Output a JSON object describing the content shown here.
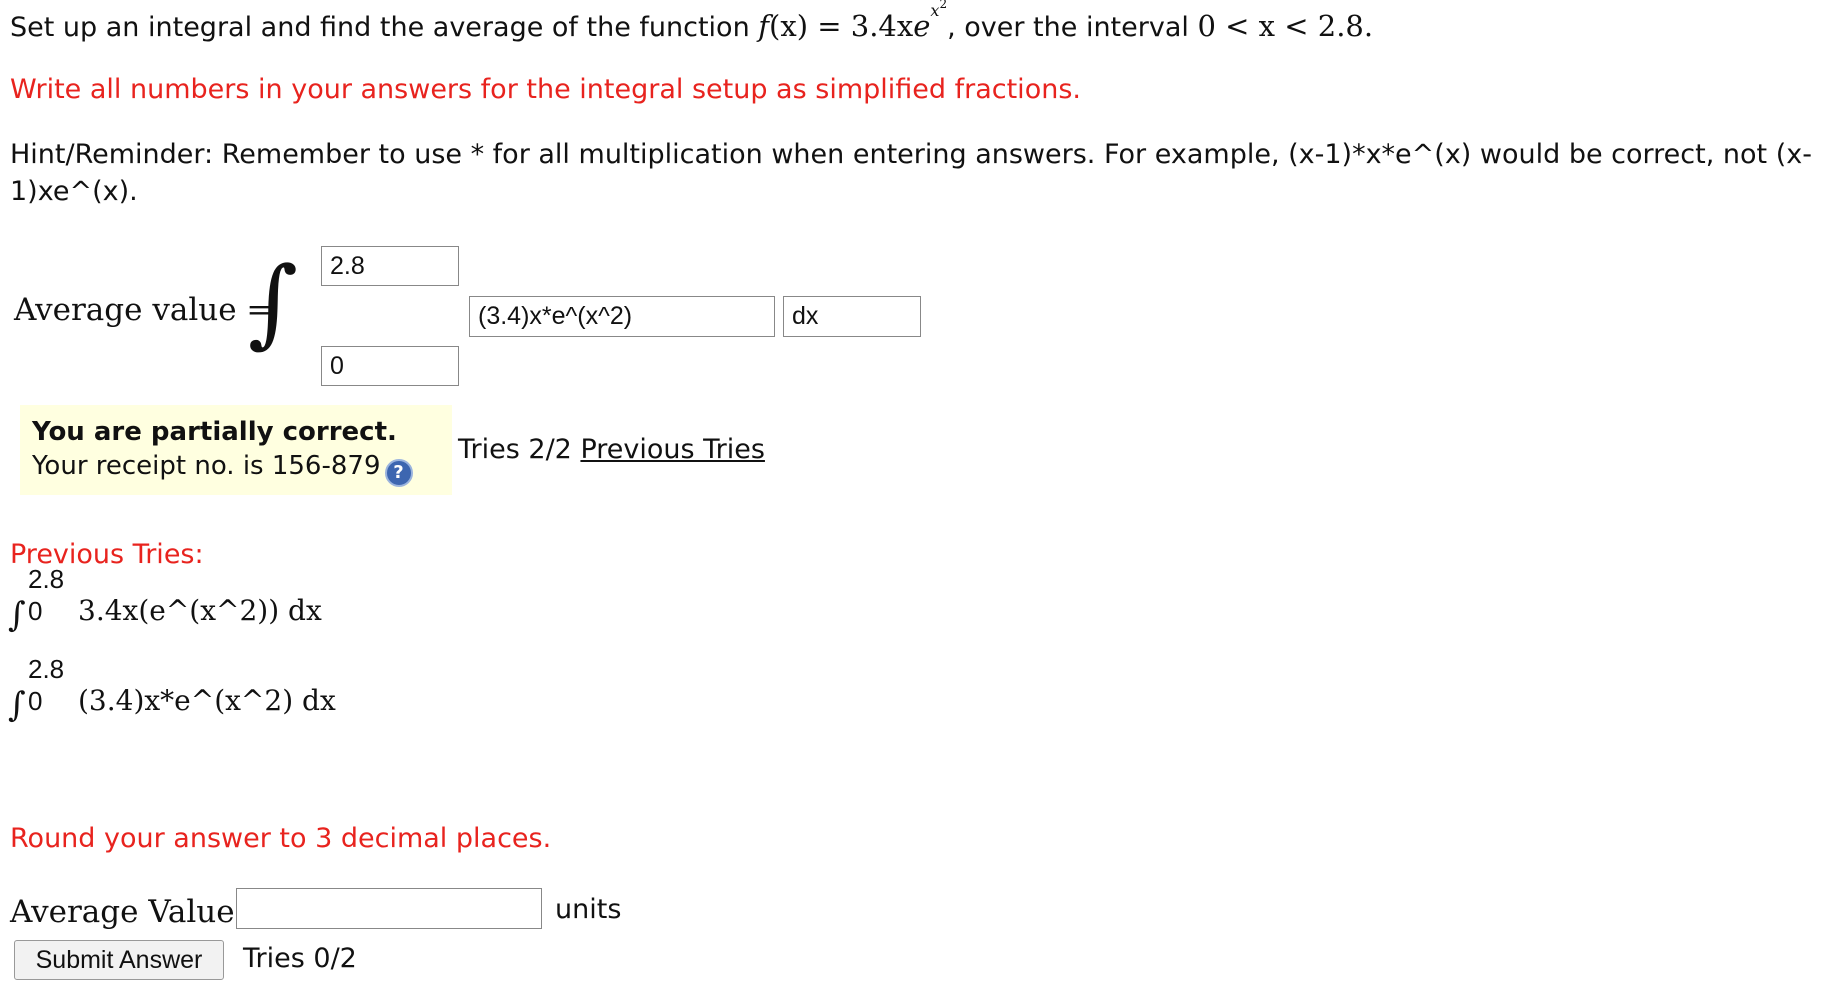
{
  "question": {
    "prefix": "Set up an integral and find the average of the function",
    "func_name": "f",
    "func_paren": "(x)",
    "equals": " = ",
    "coef": "3.4x",
    "base": "e",
    "exp_var": "x",
    "exp_pow": "2",
    "mid": ", over the interval",
    "interval": "0 < x < 2.8."
  },
  "instruction": "Write all numbers in your answers for the integral setup as simplified fractions.",
  "hint": "Hint/Reminder: Remember to use * for all multiplication when entering answers. For example, (x-1)*x*e^(x) would be correct, not (x-1)xe^(x).",
  "setup": {
    "label": "Average value =",
    "integral_symbol": "∫",
    "upper_limit": "2.8",
    "lower_limit": "0",
    "integrand": "(3.4)x*e^(x^2)",
    "differential": "dx"
  },
  "feedback": {
    "status": "You are partially correct.",
    "receipt": "Your receipt no. is 156-879",
    "help_icon": "question-mark-icon",
    "tries": "Tries 2/2",
    "previous_link": "Previous Tries"
  },
  "previous": {
    "title": "Previous Tries:",
    "items": [
      {
        "upper": "2.8",
        "lower": "0",
        "expr": "3.4x(e^(x^2)) dx"
      },
      {
        "upper": "2.8",
        "lower": "0",
        "expr": "(3.4)x*e^(x^2) dx"
      }
    ]
  },
  "answer": {
    "round_note": "Round your answer to 3 decimal places.",
    "label": "Average Value=",
    "value": "",
    "units": "units",
    "submit_label": "Submit Answer",
    "tries": "Tries 0/2"
  },
  "colors": {
    "instruction_red": "#e8231e",
    "feedback_bg": "#ffffe0",
    "help_icon_blue": "#3d66b0"
  }
}
